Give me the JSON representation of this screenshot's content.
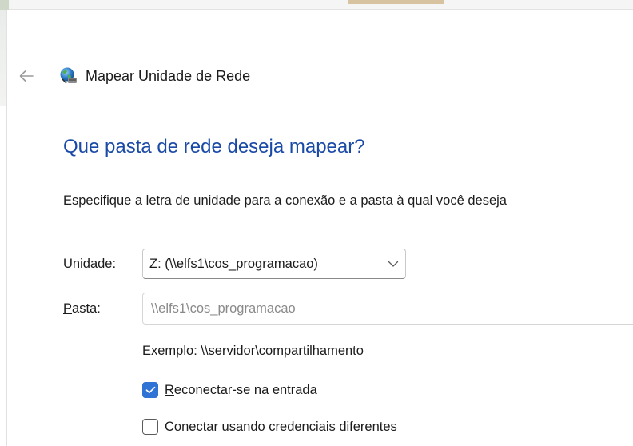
{
  "window": {
    "title": "Mapear Unidade de Rede"
  },
  "icons": {
    "back": "arrow-left-icon",
    "app": "network-drive-icon",
    "dropdown": "chevron-down-icon",
    "check": "checkmark-icon"
  },
  "colors": {
    "instruction_blue": "#1a4aa6",
    "checkbox_accent": "#2f73d4"
  },
  "content": {
    "instruction": "Que pasta de rede deseja mapear?",
    "description": "Especifique a letra de unidade para a conexão e a pasta à qual você deseja"
  },
  "form": {
    "drive_label_pre": "Un",
    "drive_label_accel": "i",
    "drive_label_post": "dade:",
    "drive_value": "Z: (\\\\elfs1\\cos_programacao)",
    "folder_label_accel": "P",
    "folder_label_post": "asta:",
    "folder_value": "\\\\elfs1\\cos_programacao",
    "example": "Exemplo: \\\\servidor\\compartilhamento",
    "reconnect_accel": "R",
    "reconnect_post": "econectar-se na entrada",
    "reconnect_checked": true,
    "credentials_pre": "Conectar ",
    "credentials_accel": "u",
    "credentials_post": "sando credenciais diferentes",
    "credentials_checked": false
  }
}
